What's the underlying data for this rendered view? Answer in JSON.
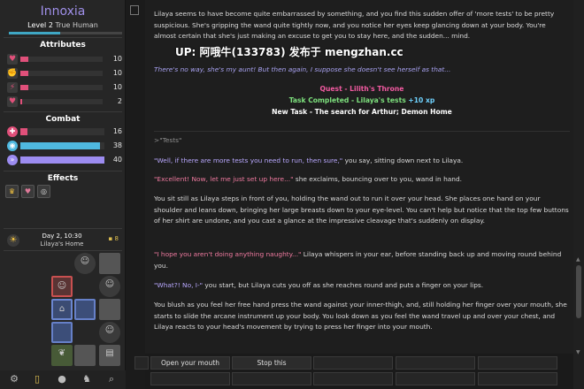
{
  "character": {
    "name": "Innoxia",
    "level": "Level 2",
    "class": "True Human",
    "xp_fraction": 0.45
  },
  "attributes": {
    "title": "Attributes",
    "items": [
      {
        "icon": "heart-icon",
        "glyph": "♥",
        "color": "#e0507a",
        "value": "10",
        "fraction": 0.1
      },
      {
        "icon": "fist-icon",
        "glyph": "✊",
        "color": "#e0507a",
        "value": "10",
        "fraction": 0.1
      },
      {
        "icon": "lightning-icon",
        "glyph": "⚡",
        "color": "#e0507a",
        "value": "10",
        "fraction": 0.1
      },
      {
        "icon": "lust-icon",
        "glyph": "♥",
        "color": "#e0507a",
        "value": "2",
        "fraction": 0.02
      }
    ]
  },
  "combat": {
    "title": "Combat",
    "items": [
      {
        "icon": "health-icon",
        "glyph": "✚",
        "color": "#e0507a",
        "value": "16",
        "fraction": 0.08
      },
      {
        "icon": "mana-icon",
        "glyph": "◉",
        "color": "#4fb9e0",
        "value": "38",
        "fraction": 0.95
      },
      {
        "icon": "arcane-icon",
        "glyph": "»",
        "color": "#9c8cf0",
        "value": "40",
        "fraction": 1.0
      }
    ]
  },
  "effects": {
    "title": "Effects",
    "items": [
      {
        "icon": "effect-crown-icon",
        "glyph": "♛",
        "color": "#f0c040"
      },
      {
        "icon": "effect-heart-icon",
        "glyph": "♥",
        "color": "#e07a9a"
      },
      {
        "icon": "effect-orb-icon",
        "glyph": "◎",
        "color": "#dddddd"
      }
    ]
  },
  "clock": {
    "time": "Day 2, 10:30",
    "location": "Lilaya's Home",
    "money": "8"
  },
  "text": {
    "p1": "Lilaya seems to have become quite embarrassed by something, and you find this sudden offer of 'more tests' to be pretty suspicious. She's gripping the wand quite tightly now, and you notice her eyes keep glancing down at your body. You're almost certain that she's just making an excuse to get you to stay here, and the sudden... mind.",
    "p2": "There's no way, she's my aunt! But then again, I suppose she doesn't see herself as that...",
    "quest": "Quest - Lilith's Throne",
    "task_completed": "Task Completed - Lilaya's tests",
    "task_xp": "+10 xp",
    "new_task": "New Task - The search for Arthur; Demon Home",
    "command": ">\"Tests\"",
    "p3_quote": "\"Well, if there are more tests you need to run, then sure,\"",
    "p3_rest": " you say, sitting down next to Lilaya.",
    "p4_quote": "\"Excellent! Now, let me just set up here...\"",
    "p4_rest": " she exclaims, bouncing over to you, wand in hand.",
    "p5": "You sit still as Lilaya steps in front of you, holding the wand out to run it over your head. She places one hand on your shoulder and leans down, bringing her large breasts down to your eye-level. You can't help but notice that the top few buttons of her shirt are undone, and you cast a glance at the impressive cleavage that's suddenly on display.",
    "p6_quote": "\"I hope you aren't doing anything naughty...\"",
    "p6_rest": " Lilaya whispers in your ear, before standing back up and moving round behind you.",
    "p7_quote": "\"What?! No, I-\"",
    "p7_rest": " you start, but Lilaya cuts you off as she reaches round and puts a finger on your lips.",
    "p8": "You blush as you feel her free hand press the wand against your inner-thigh, and, still holding her finger over your mouth, she starts to slide the arcane instrument up your body. You look down as you feel the wand travel up and over your chest, and Lilaya reacts to your head's movement by trying to press her finger into your mouth."
  },
  "watermark": "UP: 阿哦牛(133783) 发布于 mengzhan.cc",
  "actions": {
    "open_mouth": "Open your mouth",
    "stop_this": "Stop this"
  }
}
